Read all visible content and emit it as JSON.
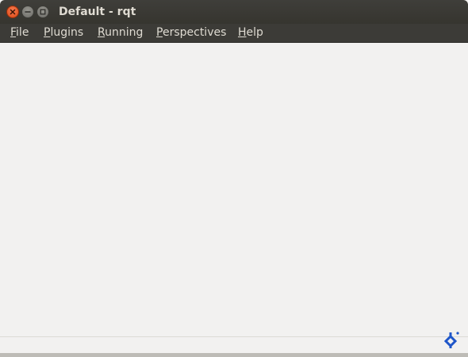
{
  "window": {
    "title": "Default - rqt"
  },
  "menubar": {
    "items": [
      {
        "mnemonic": "F",
        "rest": "ile"
      },
      {
        "mnemonic": "P",
        "rest": "lugins"
      },
      {
        "mnemonic": "R",
        "rest": "unning"
      },
      {
        "mnemonic": "P",
        "rest": "erspectives"
      },
      {
        "mnemonic": "H",
        "rest": "elp"
      }
    ]
  },
  "icons": {
    "close": "close-icon",
    "minimize": "minimize-icon",
    "maximize": "maximize-icon",
    "grip": "size-grip-icon"
  },
  "colors": {
    "titlebar": "#3c3b37",
    "title_text": "#dfdbd2",
    "close_button": "#dd4814",
    "content_bg": "#f2f1f0",
    "grip_accent": "#1f56c9"
  }
}
